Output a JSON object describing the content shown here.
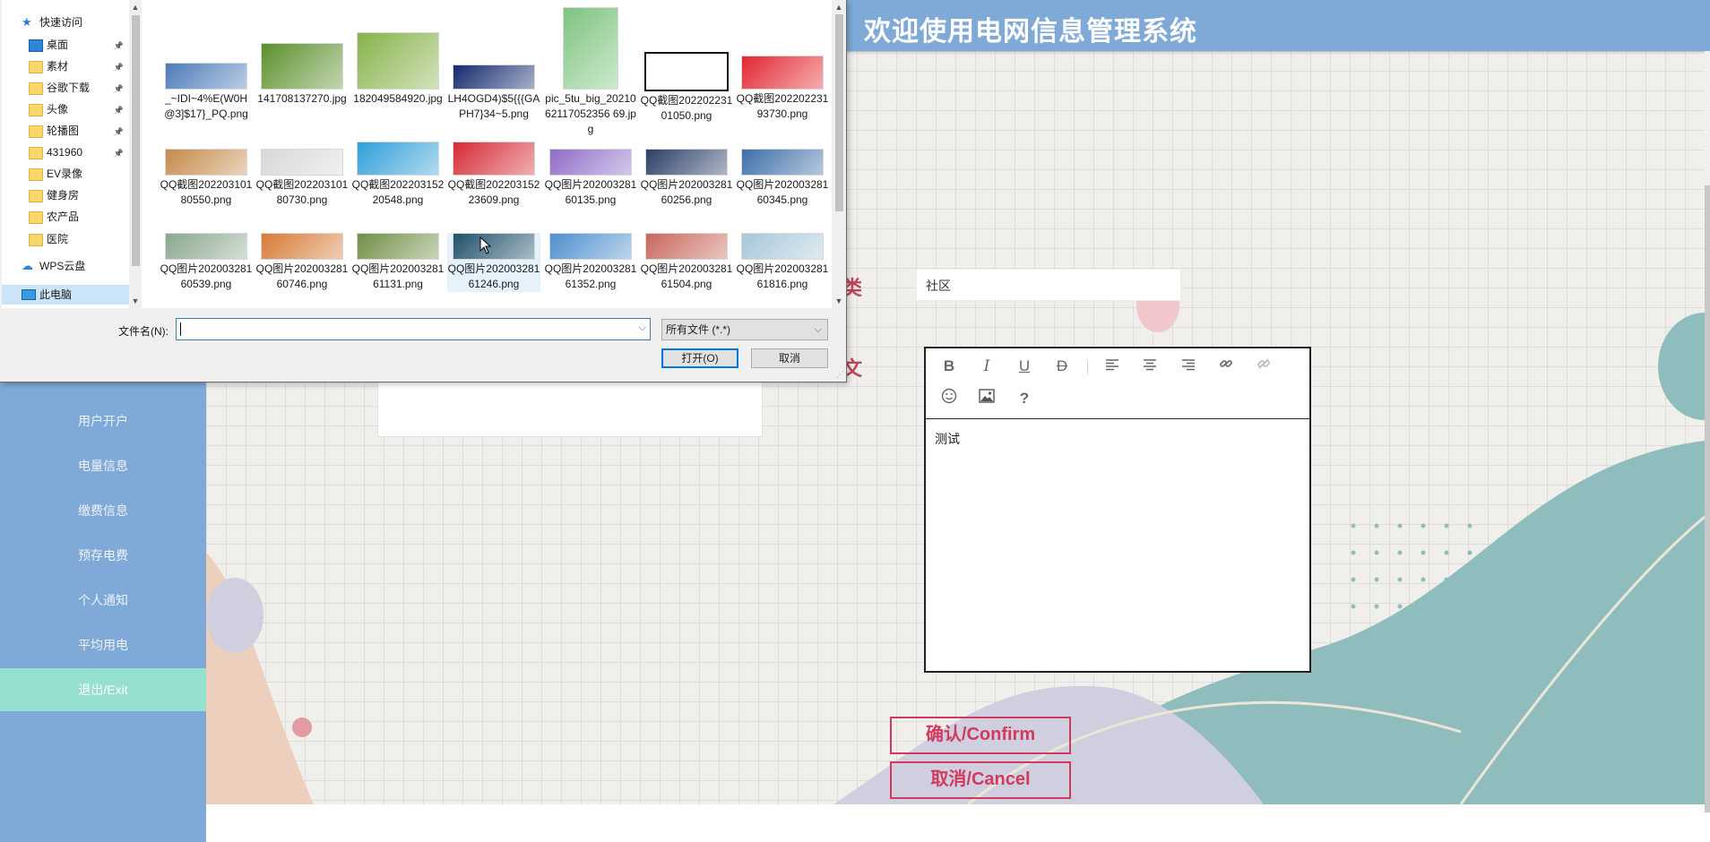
{
  "app": {
    "title": "欢迎使用电网信息管理系统"
  },
  "sidebar": {
    "items": [
      {
        "label": "用户开户",
        "active": false
      },
      {
        "label": "电量信息",
        "active": false
      },
      {
        "label": "缴费信息",
        "active": false
      },
      {
        "label": "预存电费",
        "active": false
      },
      {
        "label": "个人通知",
        "active": false
      },
      {
        "label": "平均用电",
        "active": false
      },
      {
        "label": "退出/Exit",
        "active": true
      }
    ]
  },
  "form": {
    "category_label_fragment": "类",
    "content_label_fragment": "文",
    "category_value": "社区",
    "editor_content": "测试",
    "confirm_label": "确认/Confirm",
    "cancel_label": "取消/Cancel"
  },
  "editor_toolbar": {
    "buttons": [
      "bold-icon",
      "italic-icon",
      "underline-icon",
      "strikethrough-icon",
      "align-left-icon",
      "align-center-icon",
      "align-right-icon",
      "link-icon",
      "unlink-icon",
      "emoji-icon",
      "image-icon",
      "help-icon"
    ],
    "glyphs": {
      "bold": "B",
      "italic": "I",
      "underline": "U",
      "strike": "D",
      "help": "?"
    }
  },
  "file_dialog": {
    "nav_items": [
      {
        "label": "快速访问",
        "icon": "star-icon"
      },
      {
        "label": "桌面",
        "icon": "desktop-folder-icon",
        "pinned": true
      },
      {
        "label": "素材",
        "icon": "folder-icon",
        "pinned": true
      },
      {
        "label": "谷歌下载",
        "icon": "folder-icon",
        "pinned": true
      },
      {
        "label": "头像",
        "icon": "folder-icon",
        "pinned": true
      },
      {
        "label": "轮播图",
        "icon": "folder-icon",
        "pinned": true
      },
      {
        "label": "431960",
        "icon": "folder-icon",
        "pinned": true
      },
      {
        "label": "EV录像",
        "icon": "folder-icon"
      },
      {
        "label": "健身房",
        "icon": "folder-icon"
      },
      {
        "label": "农产品",
        "icon": "folder-icon"
      },
      {
        "label": "医院",
        "icon": "folder-icon"
      },
      {
        "label": "WPS云盘",
        "icon": "cloud-icon"
      },
      {
        "label": "此电脑",
        "icon": "computer-icon",
        "selected": true
      }
    ],
    "files": [
      {
        "name": "_~IDI~4%E(W0H@3]$17}_PQ.png",
        "color": "#4b7bb8"
      },
      {
        "name": "141708137270.jpg",
        "color": "#5b8f2c"
      },
      {
        "name": "182049584920.jpg",
        "color": "#86b34a"
      },
      {
        "name": "LH4OGD4)$5{{{GAPH7}34~5.png",
        "color": "#142a6e"
      },
      {
        "name": "pic_5tu_big_2021062117052356 69.jpg",
        "color": "#7cc47f"
      },
      {
        "name": "QQ截图20220223101050.png",
        "color": "#ffffff"
      },
      {
        "name": "QQ截图20220223193730.png",
        "color": "#e3262f"
      },
      {
        "name": "QQ截图20220310180550.png",
        "color": "#c58a4a"
      },
      {
        "name": "QQ截图20220310180730.png",
        "color": "#d8d8d8"
      },
      {
        "name": "QQ截图20220315220548.png",
        "color": "#2f9fd8"
      },
      {
        "name": "QQ截图20220315223609.png",
        "color": "#d62a35"
      },
      {
        "name": "QQ图片20200328160135.png",
        "color": "#8e6cc8"
      },
      {
        "name": "QQ图片20200328160256.png",
        "color": "#2a3f66"
      },
      {
        "name": "QQ图片20200328160345.png",
        "color": "#3c6ea8"
      },
      {
        "name": "QQ图片20200328160539.png",
        "color": "#8aa88e"
      },
      {
        "name": "QQ图片20200328160746.png",
        "color": "#d77a36"
      },
      {
        "name": "QQ图片20200328161131.png",
        "color": "#6f8f45"
      },
      {
        "name": "QQ图片20200328161246.png",
        "color": "#1f4f6a"
      },
      {
        "name": "QQ图片20200328161352.png",
        "color": "#4d8fd0"
      },
      {
        "name": "QQ图片20200328161504.png",
        "color": "#c8675b"
      },
      {
        "name": "QQ图片20200328161816.png",
        "color": "#a7c7d9"
      }
    ],
    "filename_label": "文件名(N):",
    "filename_value": "",
    "filetype_value": "所有文件 (*.*)",
    "open_label": "打开(O)",
    "cancel_label": "取消"
  }
}
